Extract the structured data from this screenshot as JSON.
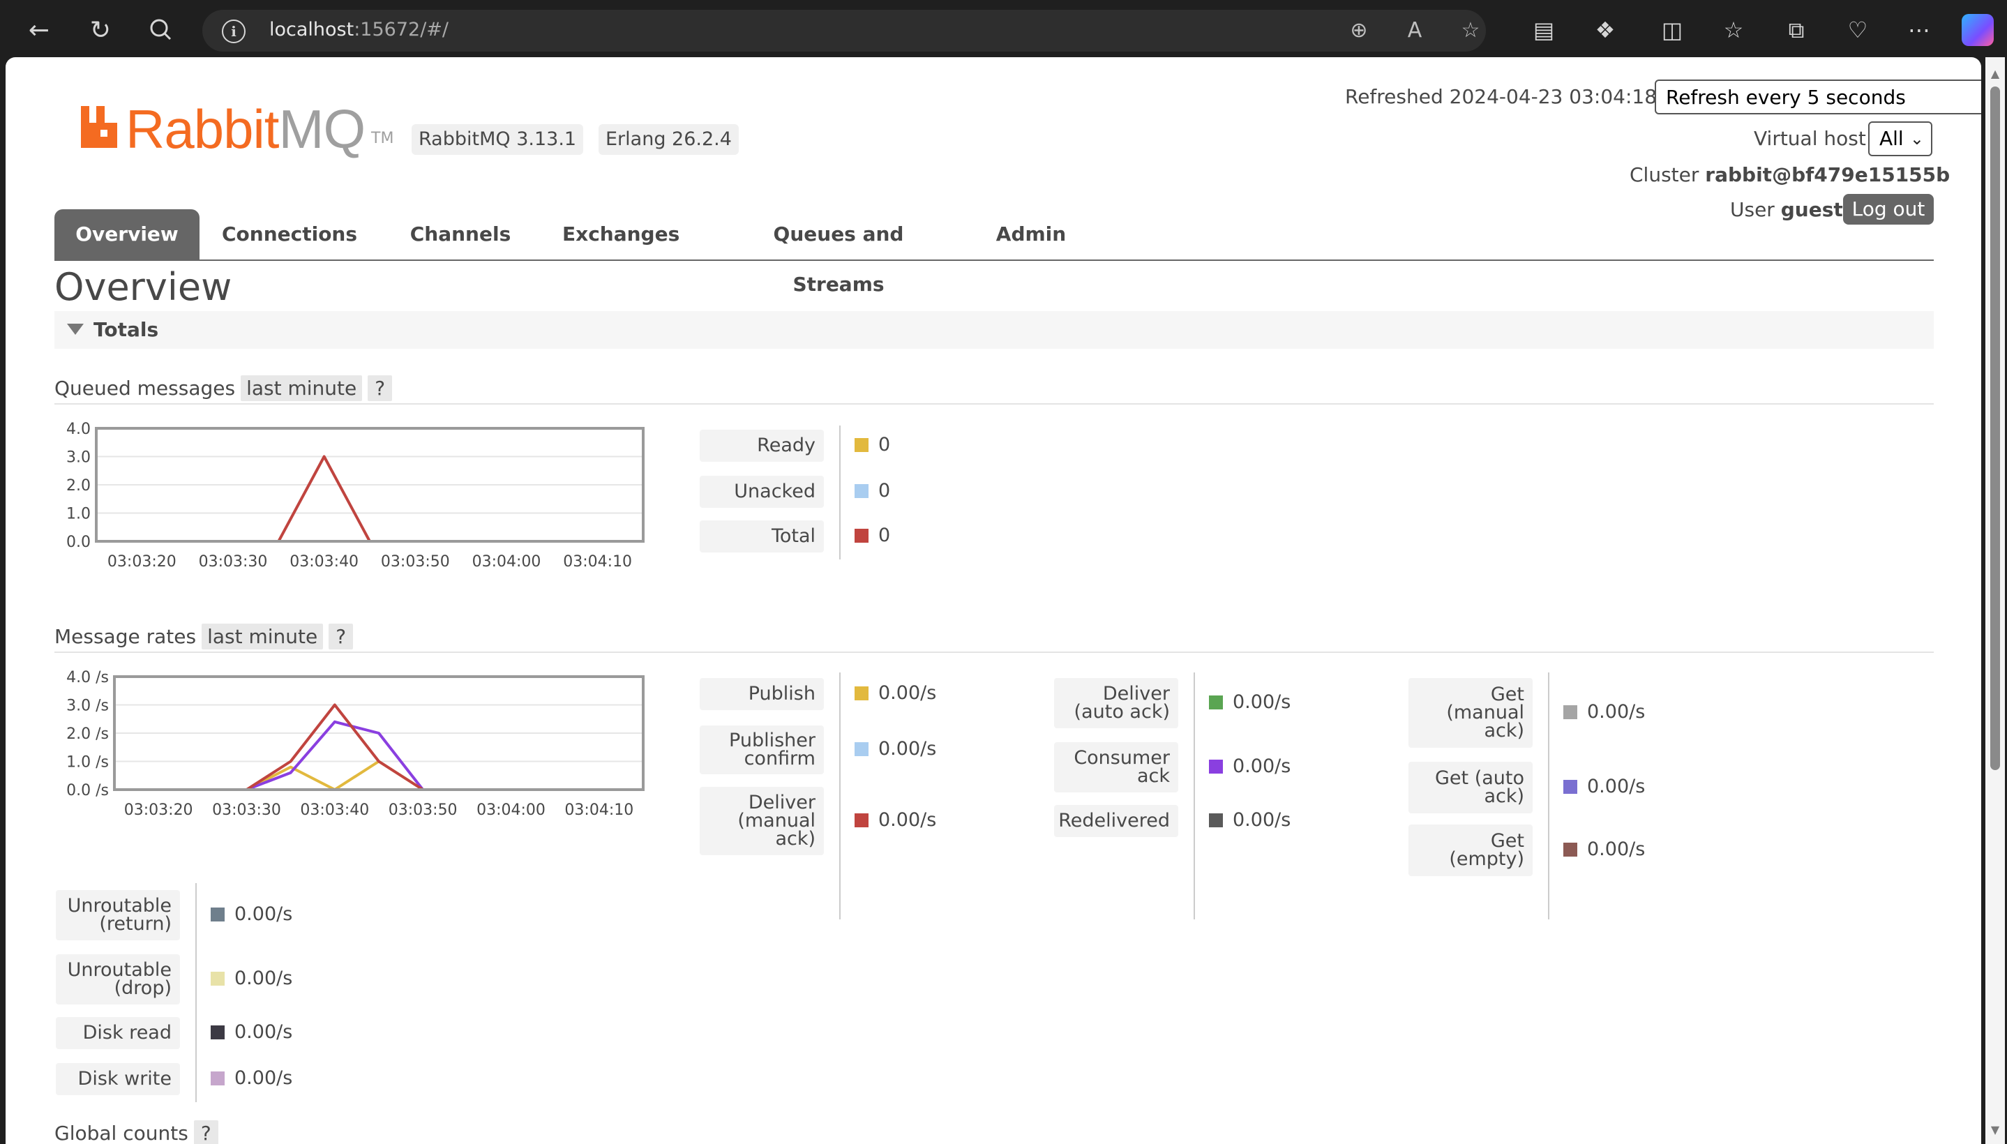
{
  "browser": {
    "url_host": "localhost",
    "url_rest": ":15672/#/",
    "icons": [
      "back-arrow-icon",
      "refresh-icon",
      "search-icon",
      "info-icon",
      "zoom-icon",
      "read-aloud-icon",
      "favorite-star-icon",
      "reading-view-icon",
      "extensions-icon",
      "split-screen-icon",
      "favorites-icon",
      "collections-icon",
      "browser-essentials-icon",
      "more-icon",
      "copilot-icon"
    ]
  },
  "header": {
    "logo_rabbit": "Rabbit",
    "logo_mq": "MQ",
    "logo_tm": "TM",
    "version_badge": "RabbitMQ 3.13.1",
    "erlang_badge": "Erlang 26.2.4",
    "refreshed": "Refreshed 2024-04-23 03:04:18",
    "refresh_select": "Refresh every 5 seconds",
    "vhost_label": "Virtual host",
    "vhost_value": "All",
    "cluster_label": "Cluster",
    "cluster_value": "rabbit@bf479e15155b",
    "user_label": "User",
    "user_value": "guest",
    "logout_label": "Log out"
  },
  "tabs": [
    "Overview",
    "Connections",
    "Channels",
    "Exchanges",
    "Queues and Streams",
    "Admin"
  ],
  "page_title": "Overview",
  "totals_label": "Totals",
  "queued": {
    "title": "Queued messages",
    "range": "last minute",
    "help": "?",
    "stats": [
      {
        "label": "Ready",
        "value": "0",
        "color": "#e2b93e"
      },
      {
        "label": "Unacked",
        "value": "0",
        "color": "#a9cdf0"
      },
      {
        "label": "Total",
        "value": "0",
        "color": "#c0443f"
      }
    ]
  },
  "rates": {
    "title": "Message rates",
    "range": "last minute",
    "help": "?",
    "col1": [
      {
        "label": "Publish",
        "value": "0.00/s",
        "color": "#e2b93e"
      },
      {
        "label": "Publisher confirm",
        "value": "0.00/s",
        "color": "#a9cdf0"
      },
      {
        "label": "Deliver (manual ack)",
        "value": "0.00/s",
        "color": "#c0443f"
      }
    ],
    "col2": [
      {
        "label": "Deliver (auto ack)",
        "value": "0.00/s",
        "color": "#5aa552"
      },
      {
        "label": "Consumer ack",
        "value": "0.00/s",
        "color": "#8a3fe0"
      },
      {
        "label": "Redelivered",
        "value": "0.00/s",
        "color": "#5a5a5a"
      }
    ],
    "col3": [
      {
        "label": "Get (manual ack)",
        "value": "0.00/s",
        "color": "#a5a5a5"
      },
      {
        "label": "Get (auto ack)",
        "value": "0.00/s",
        "color": "#7a6fd1"
      },
      {
        "label": "Get (empty)",
        "value": "0.00/s",
        "color": "#8c5a54"
      }
    ],
    "col4": [
      {
        "label": "Unroutable (return)",
        "value": "0.00/s",
        "color": "#6f7f8c"
      },
      {
        "label": "Unroutable (drop)",
        "value": "0.00/s",
        "color": "#e8e2a8"
      },
      {
        "label": "Disk read",
        "value": "0.00/s",
        "color": "#3c3a44"
      },
      {
        "label": "Disk write",
        "value": "0.00/s",
        "color": "#c6a6cc"
      }
    ]
  },
  "global_counts": {
    "title": "Global counts",
    "help": "?"
  },
  "chart_data": [
    {
      "type": "line",
      "x": [
        "03:03:15",
        "03:03:20",
        "03:03:25",
        "03:03:30",
        "03:03:35",
        "03:03:40",
        "03:03:45",
        "03:03:50",
        "03:03:55",
        "03:04:00",
        "03:04:05",
        "03:04:10",
        "03:04:15"
      ],
      "xticks": [
        "03:03:20",
        "03:03:30",
        "03:03:40",
        "03:03:50",
        "03:04:00",
        "03:04:10"
      ],
      "yticks": [
        "4.0",
        "3.0",
        "2.0",
        "1.0",
        "0.0"
      ],
      "ylim": [
        0,
        4
      ],
      "series": [
        {
          "name": "Ready",
          "color": "#e2b93e",
          "values": [
            0,
            0,
            0,
            0,
            0,
            0,
            0,
            0,
            0,
            0,
            0,
            0,
            0
          ]
        },
        {
          "name": "Unacked",
          "color": "#a9cdf0",
          "values": [
            0,
            0,
            0,
            0,
            0,
            0,
            0,
            0,
            0,
            0,
            0,
            0,
            0
          ]
        },
        {
          "name": "Total",
          "color": "#c0443f",
          "values": [
            0,
            0,
            0,
            0,
            0,
            3,
            0,
            0,
            0,
            0,
            0,
            0,
            0
          ]
        }
      ]
    },
    {
      "type": "line",
      "x": [
        "03:03:15",
        "03:03:20",
        "03:03:25",
        "03:03:30",
        "03:03:35",
        "03:03:40",
        "03:03:45",
        "03:03:50",
        "03:03:55",
        "03:04:00",
        "03:04:05",
        "03:04:10",
        "03:04:15"
      ],
      "xticks": [
        "03:03:20",
        "03:03:30",
        "03:03:40",
        "03:03:50",
        "03:04:00",
        "03:04:10"
      ],
      "yticks": [
        "4.0 /s",
        "3.0 /s",
        "2.0 /s",
        "1.0 /s",
        "0.0 /s"
      ],
      "ylim": [
        0,
        4
      ],
      "series": [
        {
          "name": "Publish",
          "color": "#e2b93e",
          "values": [
            0,
            0,
            0,
            0,
            0.8,
            0,
            1.0,
            0,
            0,
            0,
            0,
            0,
            0
          ]
        },
        {
          "name": "Consumer ack",
          "color": "#8a3fe0",
          "values": [
            0,
            0,
            0,
            0,
            0.6,
            2.4,
            2.0,
            0,
            0,
            0,
            0,
            0,
            0
          ]
        },
        {
          "name": "Deliver (manual ack)",
          "color": "#c0443f",
          "values": [
            0,
            0,
            0,
            0,
            1.0,
            3.0,
            1.0,
            0,
            0,
            0,
            0,
            0,
            0
          ]
        }
      ]
    }
  ]
}
